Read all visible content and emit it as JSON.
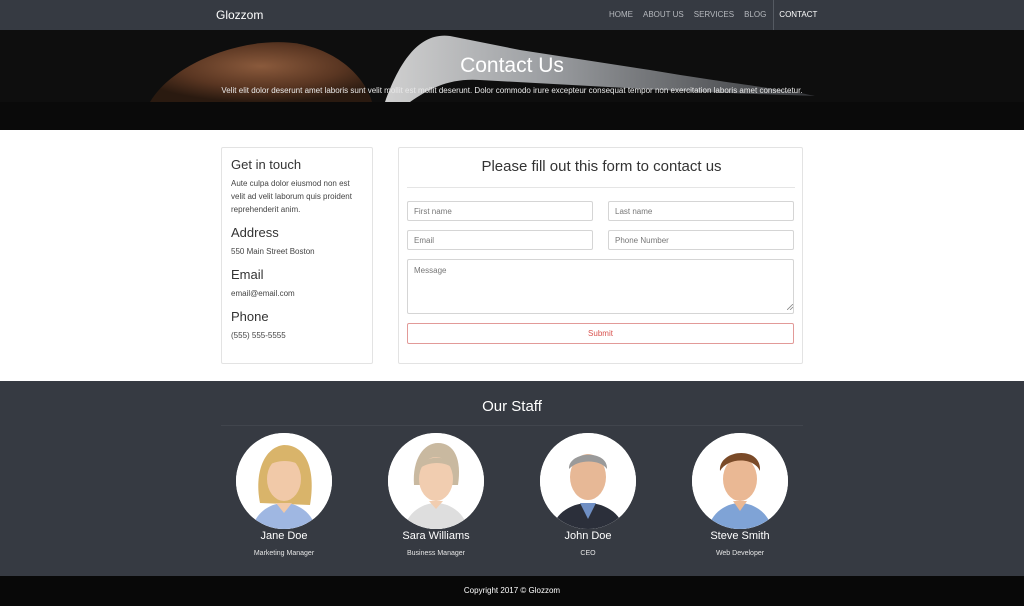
{
  "navbar": {
    "brand": "Glozzom",
    "links": [
      "HOME",
      "ABOUT US",
      "SERVICES",
      "BLOG",
      "CONTACT"
    ]
  },
  "hero": {
    "title": "Contact Us",
    "subtitle": "Velit elit dolor deserunt amet laboris sunt velit mollit est mollit deserunt. Dolor commodo irure excepteur consequat tempor non exercitation laboris amet consectetur."
  },
  "info": {
    "get_in_touch_title": "Get in touch",
    "get_in_touch_text": "Aute culpa dolor eiusmod non est velit ad velit laborum quis proident reprehenderit anim.",
    "address_title": "Address",
    "address_value": "550 Main Street Boston",
    "email_title": "Email",
    "email_value": "email@email.com",
    "phone_title": "Phone",
    "phone_value": "(555) 555-5555"
  },
  "form": {
    "title": "Please fill out this form to contact us",
    "first_name_placeholder": "First name",
    "last_name_placeholder": "Last name",
    "email_placeholder": "Email",
    "phone_placeholder": "Phone Number",
    "message_placeholder": "Message",
    "submit_label": "Submit"
  },
  "staff": {
    "title": "Our Staff",
    "members": [
      {
        "name": "Jane Doe",
        "role": "Marketing Manager",
        "hair": "#d9b46a",
        "shirt": "#9fb7e2"
      },
      {
        "name": "Sara Williams",
        "role": "Business Manager",
        "hair": "#c9b9a0",
        "shirt": "#dedede"
      },
      {
        "name": "John Doe",
        "role": "CEO",
        "hair": "#9a9a9a",
        "shirt": "#2b2f3a"
      },
      {
        "name": "Steve Smith",
        "role": "Web Developer",
        "hair": "#7a4a28",
        "shirt": "#7fa3d6"
      }
    ]
  },
  "footer": {
    "copyright": "Copyright 2017 © Glozzom"
  },
  "colors": {
    "nav_bg": "#363a42",
    "staff_bg": "#363a42",
    "footer_bg": "#080808",
    "submit_accent": "#d9534f"
  }
}
